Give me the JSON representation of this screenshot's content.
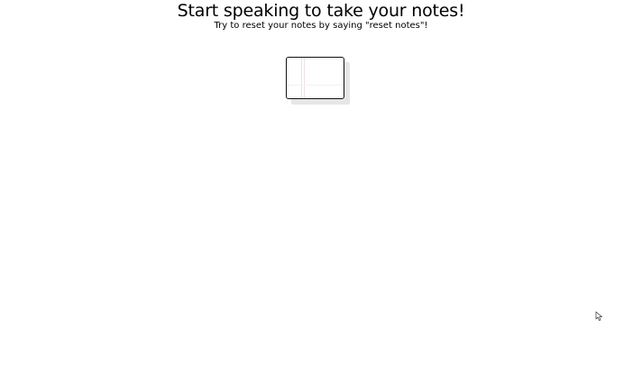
{
  "header": {
    "title": "Start speaking to take your notes!",
    "subtitle": "Try to reset your notes by saying \"reset notes\"!"
  },
  "notepad": {
    "content": ""
  },
  "icons": {
    "cursor": "mouse-pointer-icon"
  },
  "colors": {
    "background": "#ffffff",
    "text": "#000000",
    "notepad_border": "#111111",
    "notepad_shadow": "#e6e6e6"
  }
}
